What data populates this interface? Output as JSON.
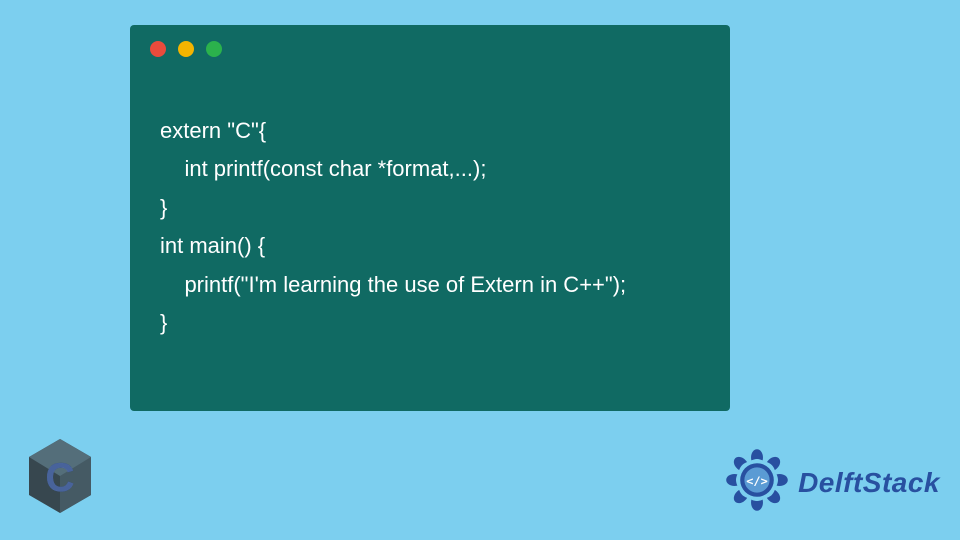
{
  "code": {
    "lines": [
      "extern \"C\"{",
      "    int printf(const char *format,...);",
      "}",
      "int main() {",
      "    printf(\"I'm learning the use of Extern in C++\");",
      "}"
    ]
  },
  "window": {
    "dots": [
      "red",
      "yellow",
      "green"
    ]
  },
  "logos": {
    "c_letter": "C",
    "delftstack_text": "DelftStack"
  },
  "colors": {
    "bg": "#7ccfef",
    "window": "#106a63",
    "code_text": "#ffffff",
    "brand_blue": "#2850a0",
    "c_logo_dark": "#37474f",
    "c_logo_letter": "#2b4a8b"
  }
}
